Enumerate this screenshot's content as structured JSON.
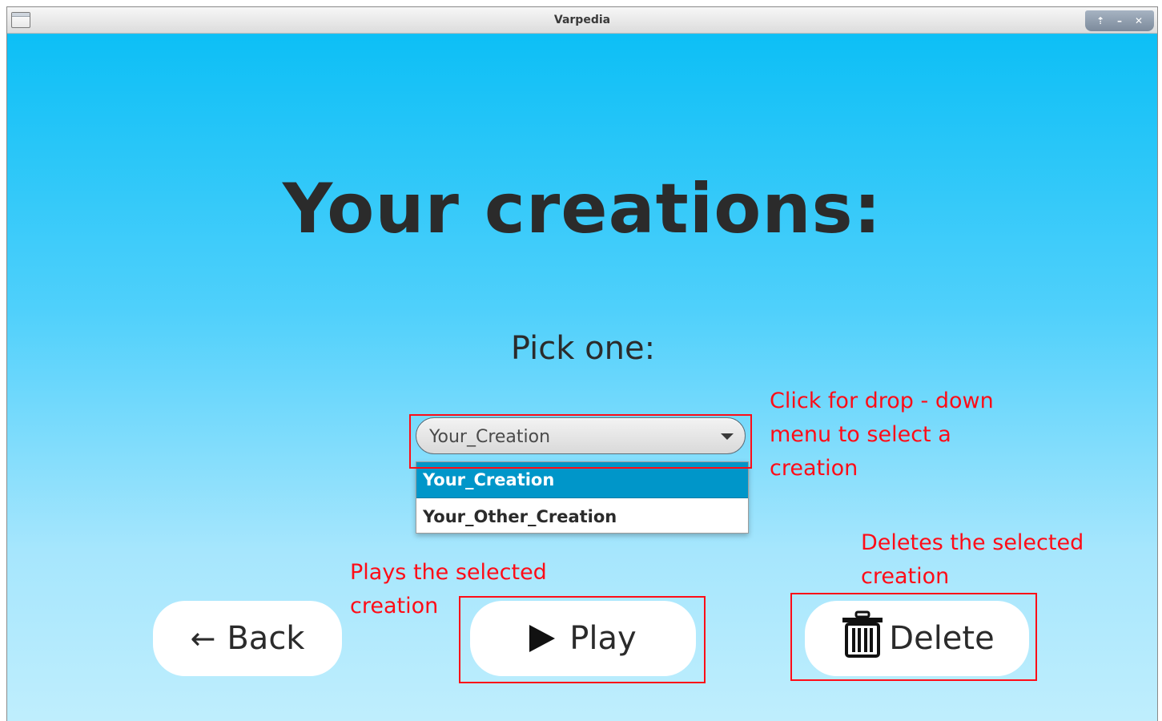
{
  "window": {
    "title": "Varpedia",
    "controls": [
      "⇡",
      "–",
      "✕"
    ]
  },
  "heading": "Your creations:",
  "subheading": "Pick one:",
  "combo": {
    "value": "Your_Creation",
    "options": [
      "Your_Creation",
      "Your_Other_Creation"
    ],
    "selected_index": 0
  },
  "buttons": {
    "back": {
      "arrow": "←",
      "label": "Back"
    },
    "play": {
      "label": "Play"
    },
    "delete": {
      "label": "Delete"
    }
  },
  "annotations": {
    "dropdown": "Click for drop - down\nmenu to select a\ncreation",
    "play": "Plays the selected\ncreation",
    "delete": "Deletes the selected\ncreation"
  },
  "colors": {
    "annotation": "#ff0c17",
    "selected_option": "#0096c9",
    "background_top": "#0dbff6",
    "background_bottom": "#bfeefd"
  }
}
